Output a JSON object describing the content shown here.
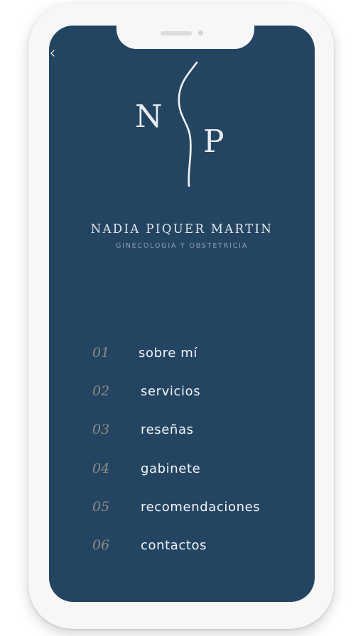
{
  "brand": {
    "monogram_left": "N",
    "monogram_right": "P",
    "name": "NADIA PIQUER MARTIN",
    "subtitle": "GINECOLOGIA Y OBSTETRICIA"
  },
  "menu": {
    "items": [
      {
        "number": "01",
        "label": "sobre mí"
      },
      {
        "number": "02",
        "label": "servicios"
      },
      {
        "number": "03",
        "label": "reseñas"
      },
      {
        "number": "04",
        "label": "gabinete"
      },
      {
        "number": "05",
        "label": "recomendaciones"
      },
      {
        "number": "06",
        "label": "contactos"
      }
    ]
  },
  "colors": {
    "background": "#244562",
    "phone_frame": "#f7f7f8",
    "menu_number": "#8e8a84",
    "menu_label": "#f2f4f7"
  },
  "icons": {
    "back": "chevron-left-icon",
    "logo": "monogram-logo-icon"
  }
}
